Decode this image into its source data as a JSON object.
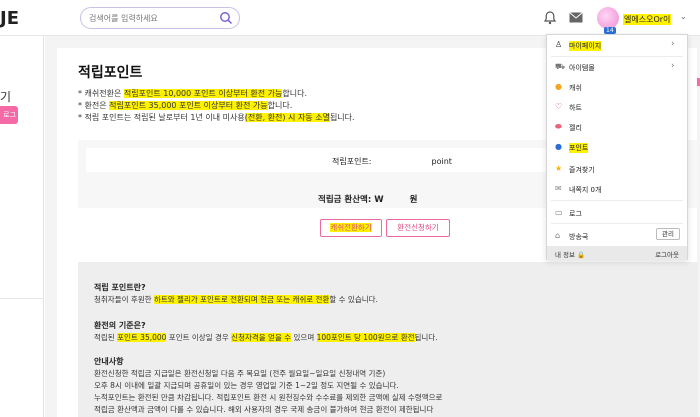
{
  "header": {
    "logo": "JE",
    "search_placeholder": "검색어를 입력하세요",
    "nickname": "엘에스오Or이",
    "avatar_level": "14"
  },
  "left": {
    "char": "기",
    "button": "로그인"
  },
  "page": {
    "title": "적립포인트",
    "notes": [
      {
        "prefix": "* 캐쉬전환은 ",
        "hl1": "적립포인트 10,000 포인트 이상부터 환전 가능",
        "mid": "",
        "hl2": "",
        "suffix": "합니다."
      },
      {
        "prefix": "* 환전은 ",
        "hl1": "적립포인트 35,000 포인트 이상부터 환전 가능",
        "mid": "",
        "hl2": "",
        "suffix": "합니다."
      },
      {
        "prefix": "* 적립 포인트는 적립된 날로부터 1년 이내 미사용",
        "hl1": "(전환, 환전) 시 자동 소멸",
        "mid": "",
        "hl2": "",
        "suffix": "됩니다."
      }
    ],
    "points_label": "적립포인트:",
    "points_unit": "point",
    "convert_label": "적립금 환산액: W",
    "convert_unit": "원",
    "btn_cash": "캐쉬전환하기",
    "btn_refund": "환전신청하기"
  },
  "info": {
    "h1": "적립 포인트란?",
    "p1_pre": "청취자들이 후원한 ",
    "p1_hl": "하트와 젤리가 포인트로 전환되며 현금 또는 캐쉬로 전환",
    "p1_suf": "할 수 있습니다.",
    "h2": "환전의 기준은?",
    "p2_a": "적립된 ",
    "p2_hl1": "포인트 35,000",
    "p2_b": " 포인트 이상일 경우 ",
    "p2_hl2": "신청자격을 얻을 수",
    "p2_c": " 있으며 ",
    "p2_hl3": "100포인트 당 100원으로 환전",
    "p2_d": "됩니다.",
    "h3": "안내사항",
    "lines": [
      "환전신청한 적립금 지급일은 환전신청일 다음 주 목요일 (전주 월요일~일요일 신청내역 기준)",
      "오후 8시 이내에 일괄 지급되며 공휴일이 있는 경우 영업일 기준 1~2일 정도 지연될 수 있습니다.",
      "누적포인트는 환전된 만큼 차감됩니다. 적립포인트 환전 시 원천징수와 수수료를 제외한 금액에 실제 수령액으로",
      "적립금 환산액과 금액이 다를 수 있습니다. 해외 사용자의 경우 국제 송금이 불가하여 현금 환전이 제한됩니다"
    ]
  },
  "dropdown": {
    "items": [
      {
        "label": "마이페이지",
        "icon": "person-icon",
        "glyph": "♙",
        "chev": "›",
        "hl": true
      },
      {
        "label": "아이템몰",
        "icon": "cart-icon",
        "glyph": "⛟",
        "chev": "›",
        "hl": false
      },
      {
        "label": "캐쉬",
        "icon": "coin-icon",
        "glyph": "●",
        "chev": "",
        "hl": false
      },
      {
        "label": "하트",
        "icon": "heart-icon",
        "glyph": "♡",
        "chev": "",
        "hl": false
      },
      {
        "label": "젤리",
        "icon": "jelly-icon",
        "glyph": "⬬",
        "chev": "",
        "hl": false
      },
      {
        "label": "포인트",
        "icon": "point-icon",
        "glyph": "●",
        "chev": "",
        "hl": true
      },
      {
        "label": "즐겨찾기",
        "icon": "star-icon",
        "glyph": "★",
        "chev": "",
        "hl": false
      },
      {
        "label": "내쪽지 0개",
        "icon": "message-icon",
        "glyph": "✉",
        "chev": "",
        "hl": false
      },
      {
        "label": "로그",
        "icon": "monitor-icon",
        "glyph": "▭",
        "chev": "",
        "hl": false
      },
      {
        "label": "방송국",
        "icon": "broadcast-icon",
        "glyph": "⌂",
        "chev": "",
        "hl": false
      }
    ],
    "manage": "관리",
    "footer_left": "내 정보",
    "footer_right": "로그아웃"
  },
  "colors": {
    "highlight": "#fff200",
    "accent": "#ec6aa0",
    "purple": "#7b61d9"
  }
}
